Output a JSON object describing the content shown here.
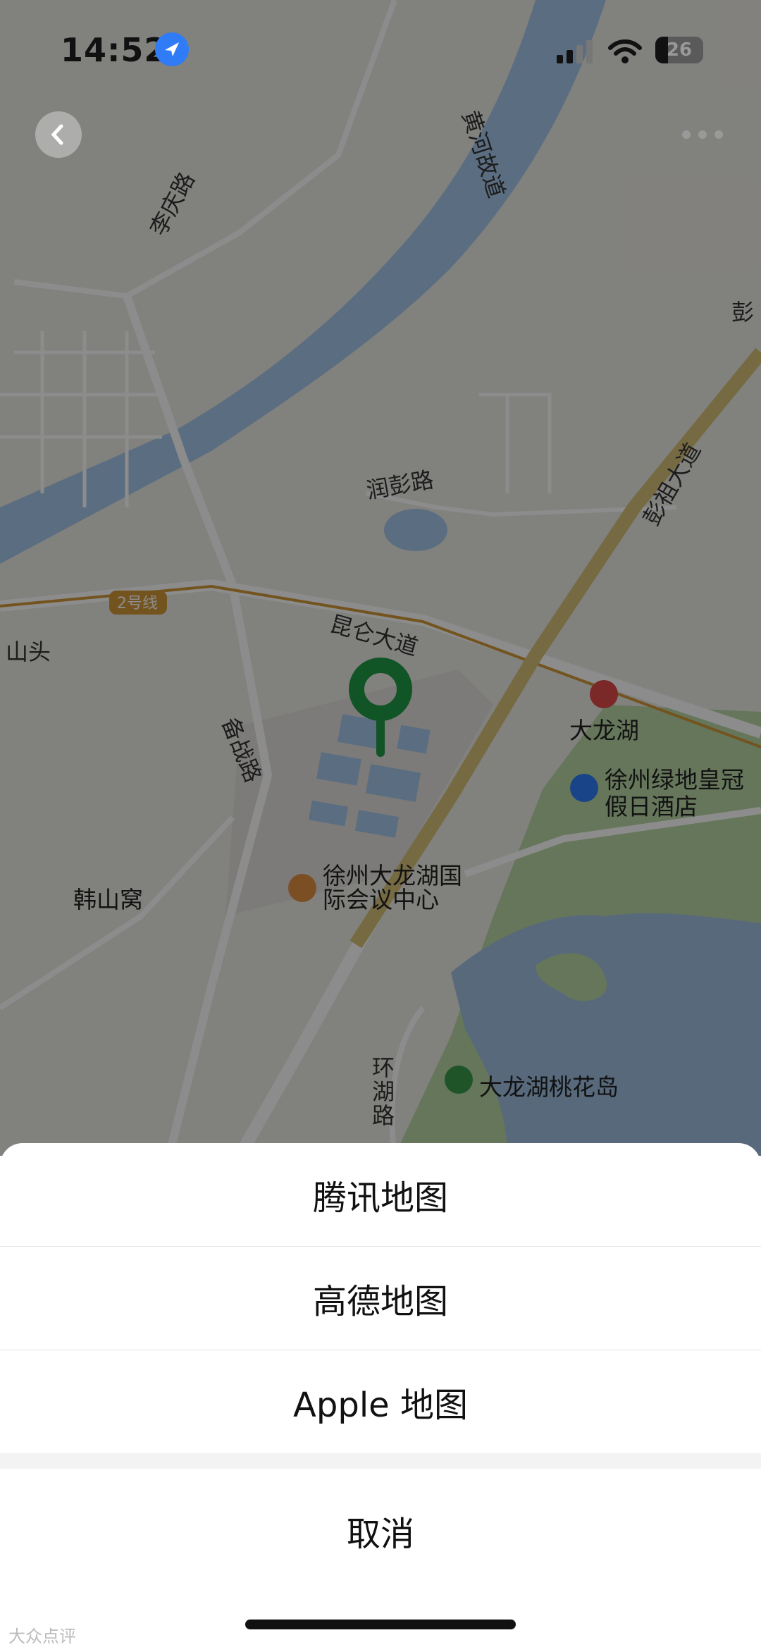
{
  "status_bar": {
    "time": "14:52",
    "battery": "26"
  },
  "map": {
    "labels": {
      "huanghe_gudao": "黄河故道",
      "liqing_lu": "李庆路",
      "peng_top": "彭",
      "runpeng_lu": "润彭路",
      "pengzu_dadao": "彭祖大道",
      "line2": "2号线",
      "kunlun_dadao": "昆仑大道",
      "shantou": "山头",
      "beizhan_lu": "备战路",
      "dalonghu": "大龙湖",
      "hotel": "徐州绿地皇冠假日酒店",
      "hanshanwo": "韩山窝",
      "conference": "徐州大龙湖国际会议中心",
      "huanhu_lu": "环湖路",
      "taohuadao": "大龙湖桃花岛"
    }
  },
  "sheet": {
    "options": [
      "腾讯地图",
      "高德地图",
      "Apple 地图"
    ],
    "cancel": "取消"
  },
  "watermark": "大众点评"
}
